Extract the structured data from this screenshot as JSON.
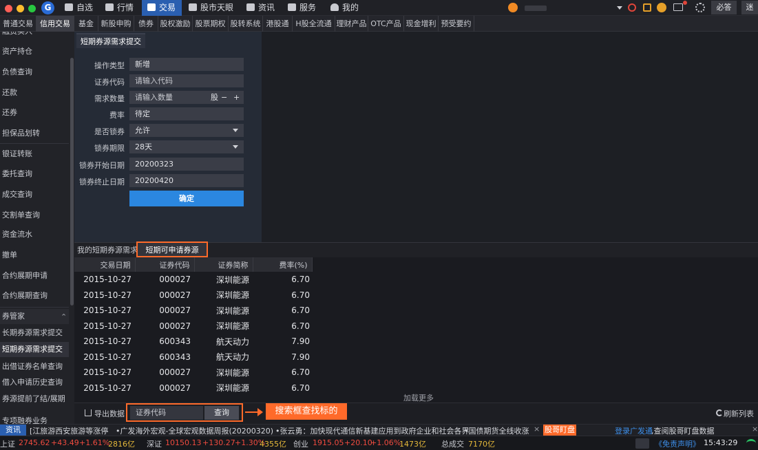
{
  "topnav": {
    "items": [
      {
        "label": "自选"
      },
      {
        "label": "行情"
      },
      {
        "label": "交易"
      },
      {
        "label": "股市天眼"
      },
      {
        "label": "资讯"
      },
      {
        "label": "服务"
      },
      {
        "label": "我的"
      }
    ],
    "right_labels": {
      "must_answer": "必答",
      "last": "迷"
    }
  },
  "subtabs": [
    "普通交易",
    "信用交易",
    "基金",
    "新股申购",
    "债券",
    "股权激励",
    "股票期权",
    "股转系统",
    "港股通",
    "H股全流通",
    "理财产品",
    "OTC产品",
    "现金增利",
    "预受要约"
  ],
  "sidebar": {
    "items": [
      "融资买入",
      "资产持仓",
      "负债查询",
      "还款",
      "还券",
      "担保品划转",
      "银证转账",
      "委托查询",
      "成交查询",
      "交割单查询",
      "资金流水",
      "撤单",
      "合约展期申请",
      "合约展期查询",
      "券管家",
      "长期券源需求提交",
      "短期券源需求提交",
      "出借证券名单查询",
      "借入申请历史查询",
      "券源提前了结/展期",
      "专项融券业务"
    ]
  },
  "form": {
    "title": "短期券源需求提交",
    "fields": [
      {
        "label": "操作类型",
        "value": "新增",
        "placeholder": ""
      },
      {
        "label": "证券代码",
        "value": "",
        "placeholder": "请输入代码"
      },
      {
        "label": "需求数量",
        "value": "",
        "placeholder": "请输入数量",
        "unit": "股",
        "minus": "−",
        "plus": "+"
      },
      {
        "label": "费率",
        "value": "待定",
        "placeholder": ""
      },
      {
        "label": "是否锁券",
        "value": "允许",
        "placeholder": ""
      },
      {
        "label": "锁券期限",
        "value": "28天",
        "placeholder": ""
      },
      {
        "label": "锁券开始日期",
        "value": "20200323",
        "placeholder": ""
      },
      {
        "label": "锁券终止日期",
        "value": "20200420",
        "placeholder": ""
      }
    ],
    "submit": "确定"
  },
  "lower": {
    "tabs": [
      "我的短期券源需求",
      "短期可申请券源"
    ],
    "columns": [
      "交易日期",
      "证券代码",
      "证券简称",
      "费率(%)"
    ],
    "rows": [
      [
        "2015-10-27",
        "000027",
        "深圳能源",
        "6.70"
      ],
      [
        "2015-10-27",
        "000027",
        "深圳能源",
        "6.70"
      ],
      [
        "2015-10-27",
        "000027",
        "深圳能源",
        "6.70"
      ],
      [
        "2015-10-27",
        "000027",
        "深圳能源",
        "6.70"
      ],
      [
        "2015-10-27",
        "600343",
        "航天动力",
        "7.90"
      ],
      [
        "2015-10-27",
        "600343",
        "航天动力",
        "7.90"
      ],
      [
        "2015-10-27",
        "000027",
        "深圳能源",
        "6.70"
      ],
      [
        "2015-10-27",
        "000027",
        "深圳能源",
        "6.70"
      ]
    ],
    "load_more": "加载更多",
    "export": "导出数据",
    "search_placeholder": "证券代码",
    "search_button": "查询",
    "annotation": "搜索框查找标的",
    "refresh": "刷新列表"
  },
  "ticker": {
    "label": "资讯",
    "items": [
      "[江旅游西安旅游等涨停",
      "•广发海外宏观-全球宏观数据周报(20200320)",
      "•张云勇：加快现代通信新基建应用到政府企业和社会各界",
      "•国债期货全线收涨"
    ],
    "badge": "股哥盯盘",
    "right_link": "登录广发通",
    "right_text": ",查阅股哥盯盘数据"
  },
  "status": {
    "sh": {
      "name": "上证",
      "value": "2745.62",
      "change": "+43.49",
      "pct": "+1.61%",
      "vol": "2816亿"
    },
    "sz": {
      "name": "深证",
      "value": "10150.13",
      "change": "+130.27",
      "pct": "+1.30%",
      "vol": "4355亿"
    },
    "cy": {
      "name": "创业",
      "value": "1915.05",
      "change": "+20.10",
      "pct": "+1.06%",
      "vol": "1473亿"
    },
    "total": {
      "label": "总成交",
      "value": "7170亿"
    },
    "disclaimer": "《免责声明》",
    "time": "15:43:29"
  },
  "colors": {
    "accent": "#2a5fb0",
    "button": "#2b87e0",
    "up": "#f04b3f",
    "annotation": "#ff6a2a"
  }
}
